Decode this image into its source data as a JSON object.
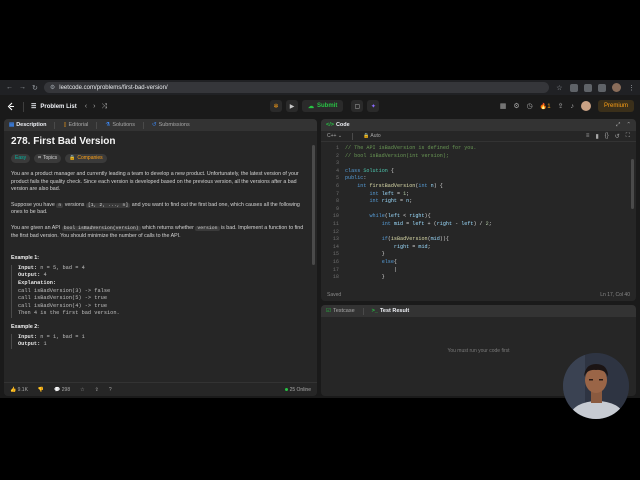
{
  "browser": {
    "url": "leetcode.com/problems/first-bad-version/"
  },
  "header": {
    "problem_list": "Problem List",
    "submit": "Submit",
    "streak": "1",
    "premium": "Premium"
  },
  "left_tabs": [
    {
      "label": "Description"
    },
    {
      "label": "Editorial"
    },
    {
      "label": "Solutions"
    },
    {
      "label": "Submissions"
    }
  ],
  "problem": {
    "title": "278. First Bad Version",
    "badges": {
      "difficulty": "Easy",
      "topics": "Topics",
      "companies": "Companies"
    },
    "p1": "You are a product manager and currently leading a team to develop a new product. Unfortunately, the latest version of your product fails the quality check. Since each version is developed based on the previous version, all the versions after a bad version are also bad.",
    "p2a": "Suppose you have ",
    "p2_code1": "n",
    "p2b": " versions ",
    "p2_code2": "[1, 2, ..., n]",
    "p2c": " and you want to find out the first bad one, which causes all the following ones to be bad.",
    "p3a": "You are given an API ",
    "p3_code1": "bool isBadVersion(version)",
    "p3b": " which returns whether ",
    "p3_code2": "version",
    "p3c": " is bad. Implement a function to find the first bad version. You should minimize the number of calls to the API.",
    "example1_title": "Example 1:",
    "example1": {
      "input_label": "Input:",
      "input": " n = 5, bad = 4",
      "output_label": "Output:",
      "output": " 4",
      "explanation_label": "Explanation:",
      "lines": [
        "call isBadVersion(3) -> false",
        "call isBadVersion(5) -> true",
        "call isBadVersion(4) -> true",
        "Then 4 is the first bad version."
      ]
    },
    "example2_title": "Example 2:",
    "example2": {
      "input_label": "Input:",
      "input": " n = 1, bad = 1",
      "output_label": "Output:",
      "output": " 1"
    }
  },
  "bottom": {
    "likes": "9.1K",
    "comments": "298",
    "online": "25 Online"
  },
  "code_panel": {
    "tab": "Code",
    "language": "C++",
    "mode": "Auto",
    "saved": "Saved",
    "cursor": "Ln 17, Col 40",
    "line_numbers": [
      "1",
      "2",
      "3",
      "4",
      "5",
      "6",
      "7",
      "8",
      "9",
      "10",
      "11",
      "12",
      "13",
      "14",
      "15",
      "16",
      "17",
      "18"
    ]
  },
  "test_panel": {
    "tab1": "Testcase",
    "tab2": "Test Result",
    "empty": "You must run your code first"
  }
}
